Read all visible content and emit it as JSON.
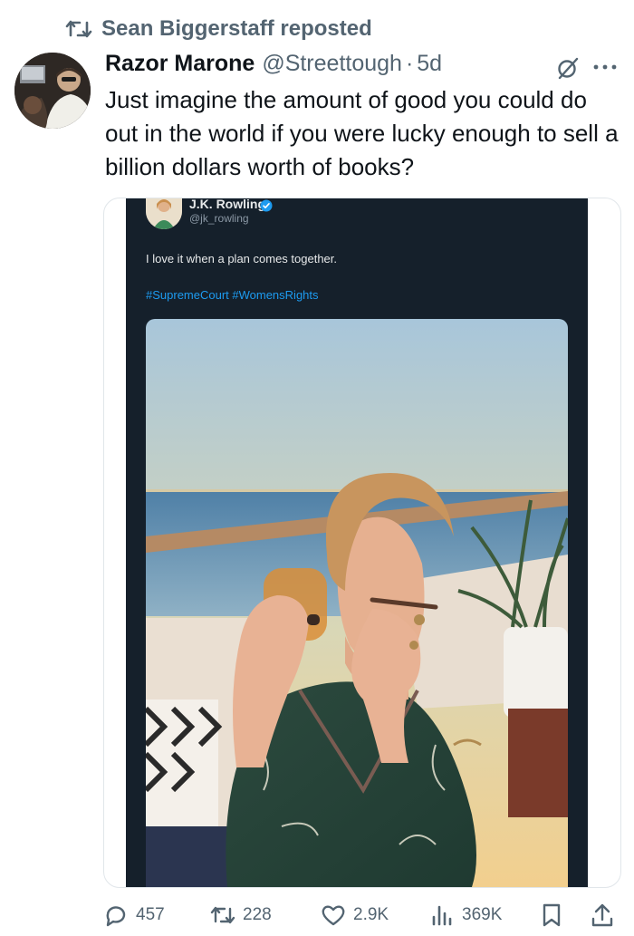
{
  "repost": {
    "text": "Sean Biggerstaff reposted",
    "icon": "repost-icon"
  },
  "post": {
    "author_name": "Razor Marone",
    "handle": "@Streettough",
    "separator": "·",
    "time": "5d",
    "text": "Just imagine the amount of good you could do out in the world if you were lucky enough to sell a billion dollars worth of books?"
  },
  "embedded": {
    "name": "J.K. Rowling",
    "handle": "@jk_rowling",
    "text": "I love it when a plan comes together.",
    "hashtags": "#SupremeCourt #WomensRights"
  },
  "actions": {
    "replies": "457",
    "reposts": "228",
    "likes": "2.9K",
    "views": "369K"
  },
  "colors": {
    "text": "#0f1419",
    "muted": "#536471",
    "dark_bg": "#15202b",
    "link": "#1d9bf0"
  }
}
